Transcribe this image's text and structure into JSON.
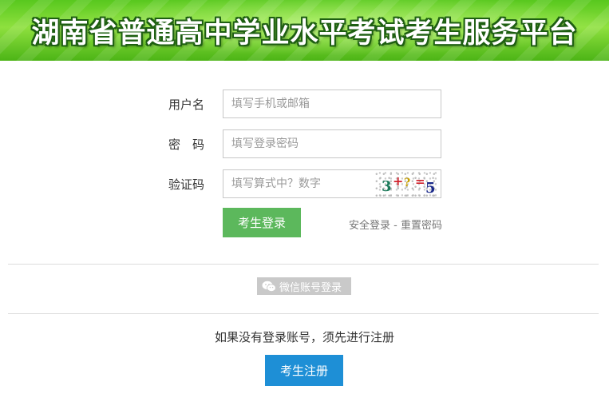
{
  "banner": {
    "title": "湖南省普通高中学业水平考试考生服务平台"
  },
  "form": {
    "username": {
      "label": "用户名",
      "placeholder": "填写手机或邮箱"
    },
    "password": {
      "label": "密　码",
      "placeholder": "填写登录密码"
    },
    "captcha": {
      "label": "验证码",
      "placeholder": "填写算式中？数字",
      "image_chars": [
        "3",
        "+",
        "?",
        "=",
        "5"
      ],
      "image_colors": [
        "#1b7a5a",
        "#d0202a",
        "#c8a000",
        "#d0202a",
        "#1b2a8a"
      ]
    },
    "login_button": "考生登录",
    "links": {
      "safe_login": "安全登录",
      "separator": "-",
      "reset_password": "重置密码"
    }
  },
  "wechat": {
    "label": "微信账号登录",
    "icon": "wechat-icon"
  },
  "register": {
    "note": "如果没有登录账号，须先进行注册",
    "button": "考生注册"
  }
}
